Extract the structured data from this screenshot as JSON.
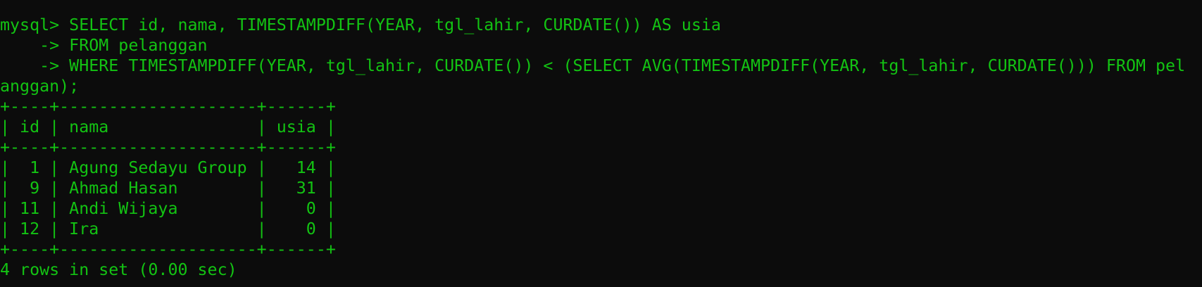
{
  "terminal": {
    "text_color": "#13c313",
    "background_color": "#0c0c0c",
    "lines": [
      "mysql> SELECT id, nama, TIMESTAMPDIFF(YEAR, tgl_lahir, CURDATE()) AS usia",
      "    -> FROM pelanggan",
      "    -> WHERE TIMESTAMPDIFF(YEAR, tgl_lahir, CURDATE()) < (SELECT AVG(TIMESTAMPDIFF(YEAR, tgl_lahir, CURDATE())) FROM pel",
      "anggan);",
      "+----+--------------------+------+",
      "| id | nama               | usia |",
      "+----+--------------------+------+",
      "|  1 | Agung Sedayu Group |   14 |",
      "|  9 | Ahmad Hasan        |   31 |",
      "| 11 | Andi Wijaya        |    0 |",
      "| 12 | Ira                |    0 |",
      "+----+--------------------+------+",
      "4 rows in set (0.00 sec)"
    ]
  }
}
